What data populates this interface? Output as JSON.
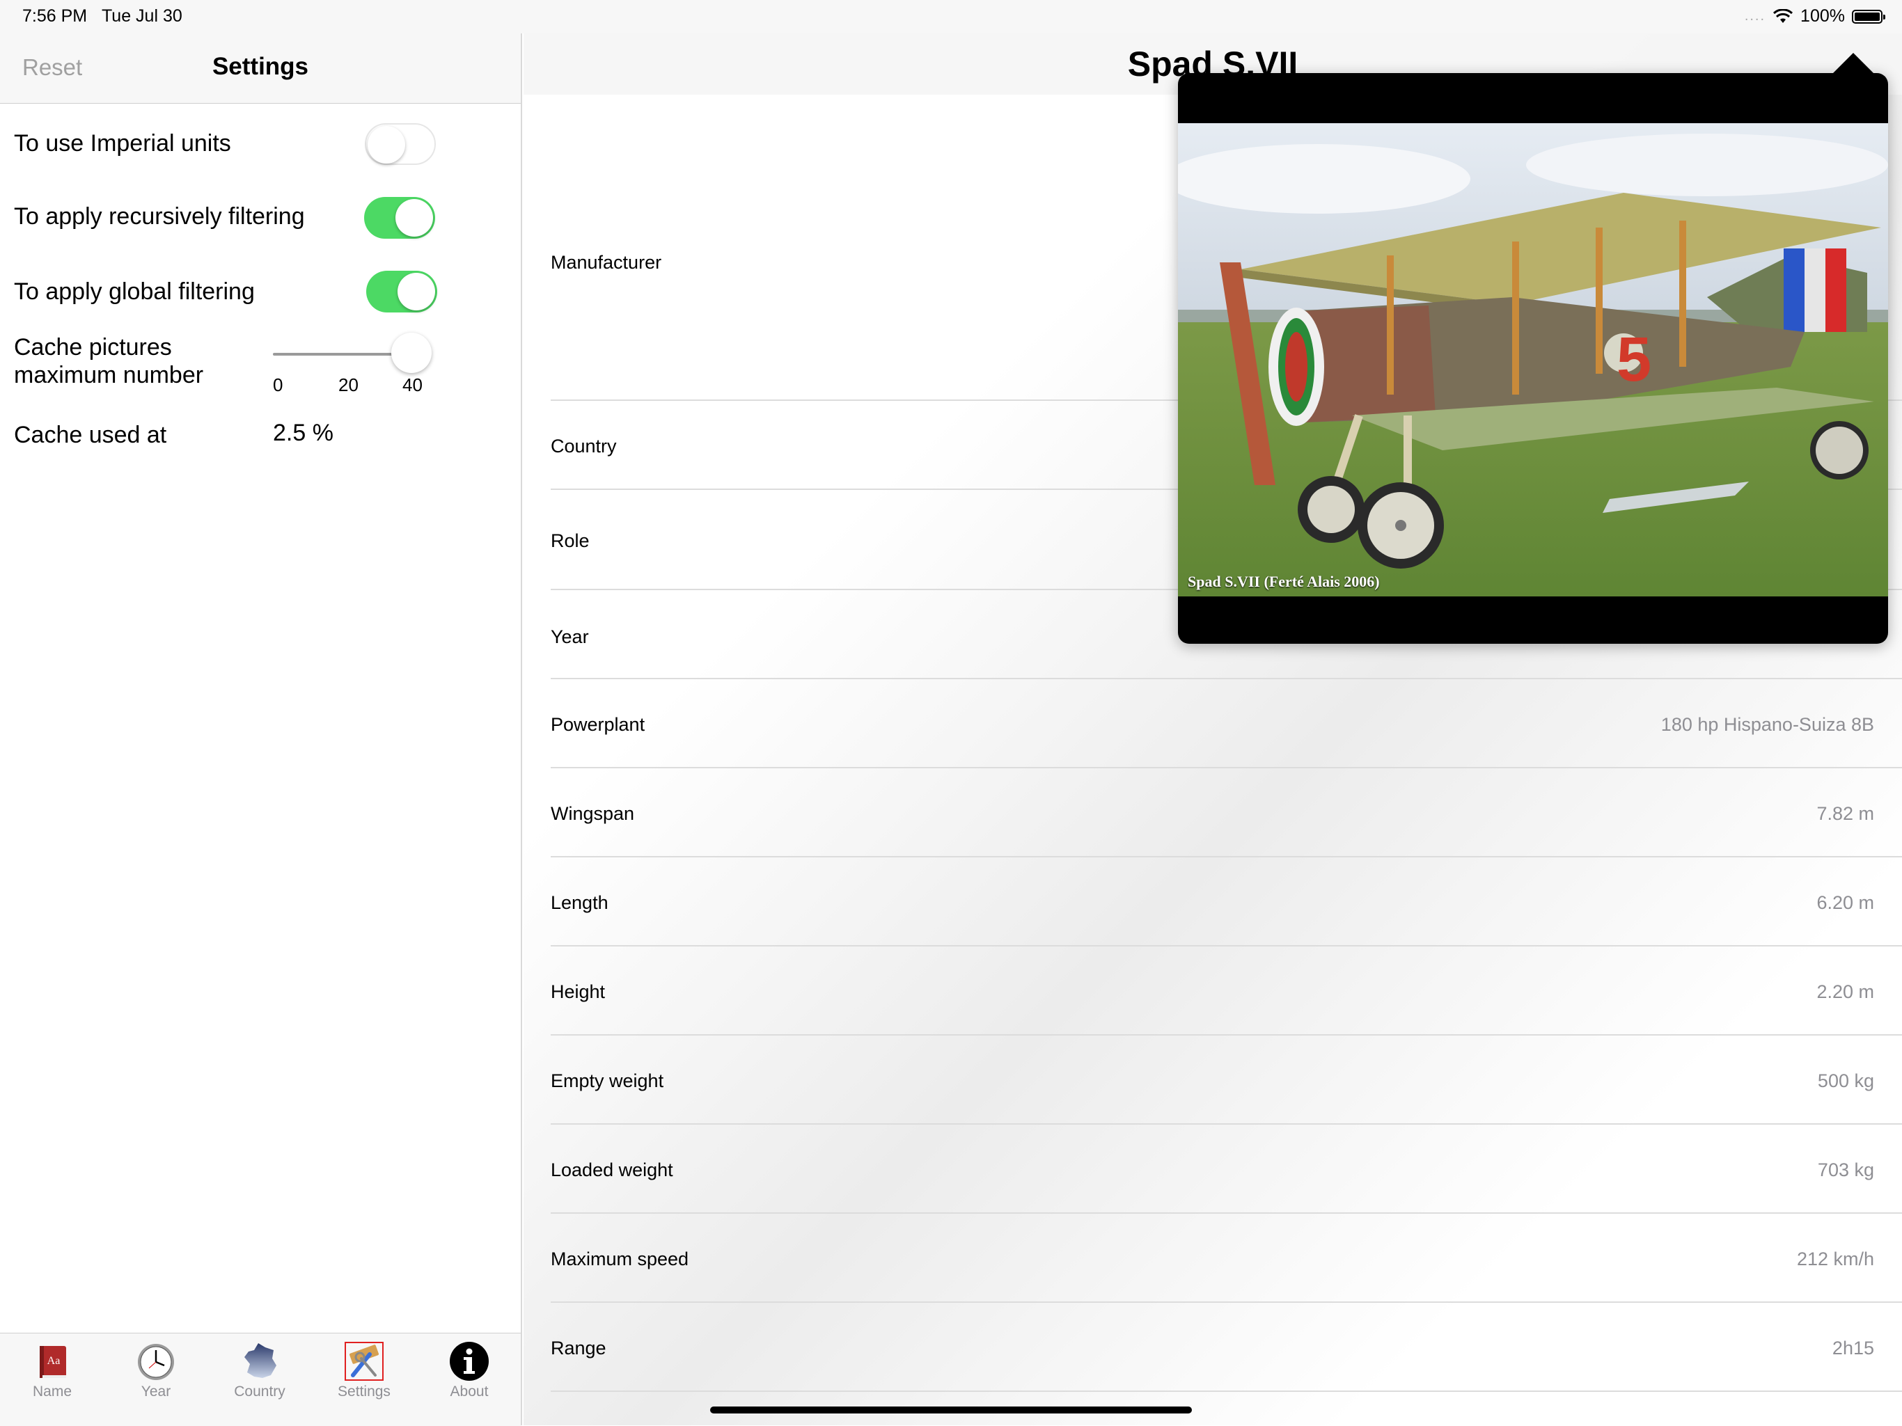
{
  "status_bar": {
    "time": "7:56 PM",
    "date": "Tue Jul 30",
    "signal": "....",
    "battery": "100%"
  },
  "settings": {
    "reset_label": "Reset",
    "title": "Settings",
    "imperial_label": "To use Imperial units",
    "imperial_on": false,
    "recursive_label": "To apply recursively filtering",
    "recursive_on": true,
    "global_label": "To apply global filtering",
    "global_on": true,
    "cache_label": "Cache pictures maximum number",
    "cache_slider": {
      "min": 0,
      "max": 40,
      "value": 40,
      "ticks": [
        "0",
        "20",
        "40"
      ]
    },
    "cache_used_label": "Cache used at",
    "cache_used_value": "2.5 %"
  },
  "tab_bar": {
    "tabs": [
      {
        "label": "Name",
        "icon": "dictionary-icon"
      },
      {
        "label": "Year",
        "icon": "clock-icon"
      },
      {
        "label": "Country",
        "icon": "france-map-icon"
      },
      {
        "label": "Settings",
        "icon": "tools-icon",
        "selected": true
      },
      {
        "label": "About",
        "icon": "info-icon"
      }
    ]
  },
  "detail": {
    "title": "Spad S.VII",
    "rows": [
      {
        "label": "Manufacturer",
        "value": ""
      },
      {
        "label": "Country",
        "value": ""
      },
      {
        "label": "Role",
        "value": ""
      },
      {
        "label": "Year",
        "value": ""
      },
      {
        "label": "Powerplant",
        "value": "180 hp Hispano-Suiza 8B"
      },
      {
        "label": "Wingspan",
        "value": "7.82 m"
      },
      {
        "label": "Length",
        "value": "6.20 m"
      },
      {
        "label": "Height",
        "value": "2.20 m"
      },
      {
        "label": "Empty weight",
        "value": "500 kg"
      },
      {
        "label": "Loaded weight",
        "value": "703 kg"
      },
      {
        "label": "Maximum speed",
        "value": "212 km/h"
      },
      {
        "label": "Range",
        "value": "2h15"
      }
    ]
  },
  "popover": {
    "caption": "Spad S.VII    (Ferté Alais 2006)"
  },
  "colors": {
    "toggle_on": "#4cd964",
    "tab_inactive": "#8e8e93",
    "value_gray": "#8e8e93"
  }
}
